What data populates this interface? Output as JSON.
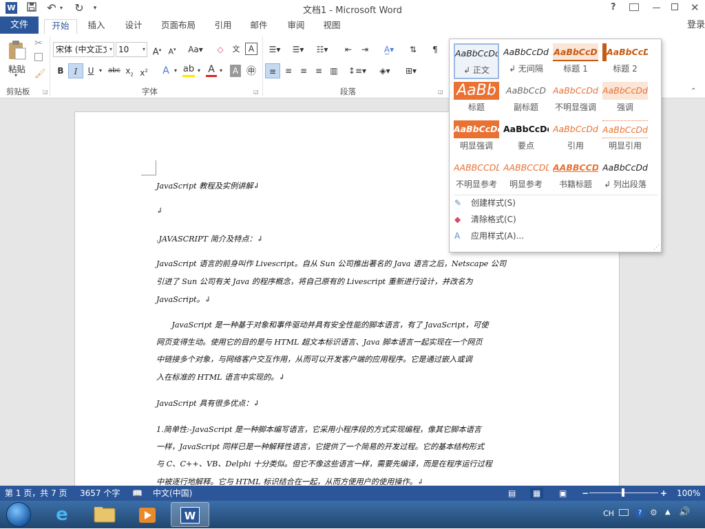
{
  "title": {
    "doc_title": "文档1 - Microsoft Word",
    "help": "?",
    "login": "登录"
  },
  "tabs": [
    {
      "label": "文件"
    },
    {
      "label": "开始"
    },
    {
      "label": "插入"
    },
    {
      "label": "设计"
    },
    {
      "label": "页面布局"
    },
    {
      "label": "引用"
    },
    {
      "label": "邮件"
    },
    {
      "label": "审阅"
    },
    {
      "label": "视图"
    }
  ],
  "ribbon": {
    "paste_label": "粘贴",
    "font_name": "宋体 (中文正文)",
    "font_size": "10",
    "groups": {
      "clipboard": "剪贴板",
      "font": "字体",
      "paragraph": "段落"
    }
  },
  "styles_panel": {
    "styles": [
      {
        "preview": "AaBbCcDdE",
        "name": "↲ 正文",
        "color": "#222222"
      },
      {
        "preview": "AaBbCcDdE",
        "name": "↲ 无间隔",
        "color": "#222222"
      },
      {
        "preview": "AaBbCcD",
        "name": "标题 1",
        "color": "#c55a11"
      },
      {
        "preview": "AaBbCcD",
        "name": "标题 2",
        "color": "#c55a11"
      },
      {
        "preview": "AaBb",
        "name": "标题",
        "color": "#e97132"
      },
      {
        "preview": "AaBbCcD",
        "name": "副标题",
        "color": "#666666"
      },
      {
        "preview": "AaBbCcDdE",
        "name": "不明显强调",
        "color": "#e97132"
      },
      {
        "preview": "AaBbCcDd",
        "name": "强调",
        "color": "#e97132"
      },
      {
        "preview": "AaBbCcDd",
        "name": "明显强调",
        "color": "#e97132"
      },
      {
        "preview": "AaBbCcDdE",
        "name": "要点",
        "color": "#111111"
      },
      {
        "preview": "AaBbCcDdE",
        "name": "引用",
        "color": "#e97132"
      },
      {
        "preview": "AaBbCcDd",
        "name": "明显引用",
        "color": "#e97132"
      },
      {
        "preview": "AABBCCDDE",
        "name": "不明显参考",
        "color": "#e97132"
      },
      {
        "preview": "AABBCCDDE",
        "name": "明显参考",
        "color": "#e97132"
      },
      {
        "preview": "AABBCCDD",
        "name": "书籍标题",
        "color": "#e97132"
      },
      {
        "preview": "AaBbCcDdE",
        "name": "↲ 列出段落",
        "color": "#222222"
      }
    ],
    "menu": [
      "创建样式(S)",
      "清除格式(C)",
      "应用样式(A)..."
    ]
  },
  "document": {
    "lines": [
      "JavaScript 教程及实例讲解↲",
      "↲",
      ".JAVASCRIPT 简介及特点：↲",
      "JavaScript 语言的前身叫作 Livescript。自从 Sun 公司推出著名的 Java 语言之后，Netscape 公司",
      "引进了 Sun 公司有关 Java 的程序概念，将自己原有的 Livescript  重新进行设计，并改名为",
      "JavaScript。↲",
      "　　JavaScript 是一种基于对象和事件驱动并具有安全性能的脚本语言，有了 JavaScript，可使",
      "网页变得生动。使用它的目的是与 HTML 超文本标识语言、Java  脚本语言一起实现在一个网页",
      "中链接多个对象，与网络客户交互作用，从而可以开发客户端的应用程序。它是通过嵌入或调",
      "入在标准的 HTML 语言中实现的。↲",
      "JavaScript 具有很多优点：↲",
      "1.简单性:-JavaScript 是一种脚本编写语言，它采用小程序段的方式实现编程，像其它脚本语言",
      "一样，JavaScript 同样已是一种解释性语言，它提供了一个简易的开发过程。它的基本结构形式",
      "与 C、C++、VB、Delphi 十分类似。但它不像这些语言一样，需要先编译，而是在程序运行过程",
      "中被逐行地解释。它与 HTML 标识结合在一起，从而方便用户的使用操作。↲"
    ]
  },
  "status": {
    "page": "第 1 页，共 7 页",
    "words": "3657 个字",
    "lang": "中文(中国)",
    "zoom": "100%"
  },
  "taskbar": {
    "ime": "CH"
  }
}
